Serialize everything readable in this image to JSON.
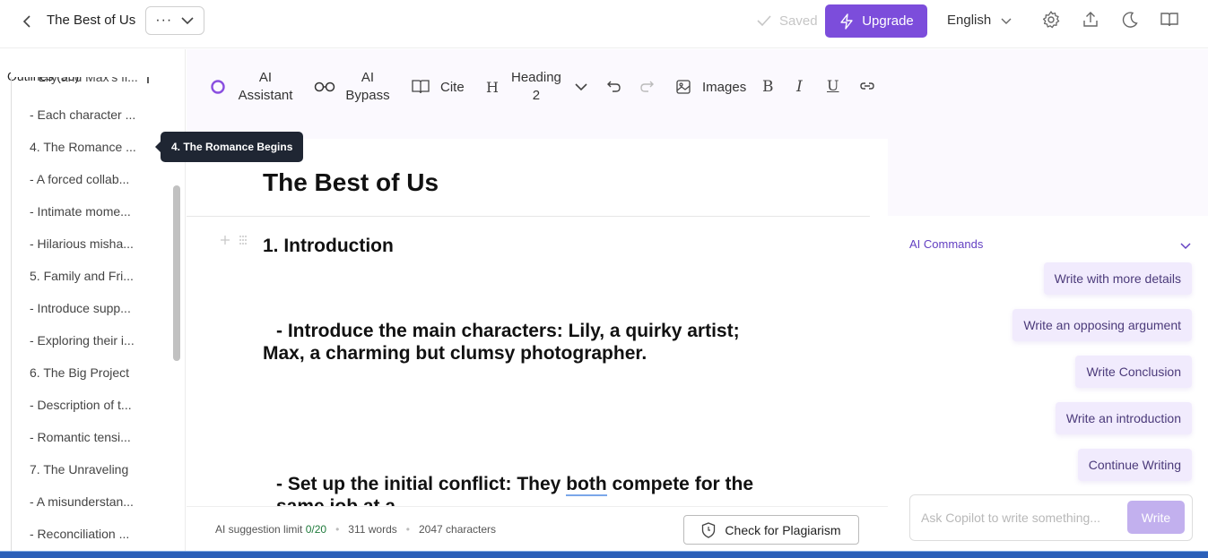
{
  "header": {
    "doc_title": "The Best of Us",
    "more_label": "···",
    "saved_label": "Saved",
    "upgrade_label": "Upgrade",
    "language": "English",
    "colors": {
      "accent": "#7c4ddb"
    }
  },
  "sidebar": {
    "outlines_label": "Outlines (35)",
    "items": [
      "Lily and Max's fi...",
      "- Each character ...",
      "4. The Romance ...",
      "- A forced collab...",
      "- Intimate mome...",
      "- Hilarious misha...",
      "5. Family and Fri...",
      "- Introduce supp...",
      "- Exploring their i...",
      "6. The Big Project",
      "- Description of t...",
      "- Romantic tensi...",
      "7. The Unraveling",
      "- A misunderstan...",
      "- Reconciliation ..."
    ],
    "tooltip": "4. The Romance Begins"
  },
  "toolbar": {
    "ai_assistant": "AI Assistant",
    "ai_bypass": "AI Bypass",
    "cite": "Cite",
    "heading": "Heading 2",
    "images": "Images"
  },
  "editor": {
    "title": "The Best of Us",
    "h1": "1. Introduction",
    "p1": "- Introduce the main characters: Lily, a quirky artist; Max, a charming but clumsy photographer.",
    "p2_a": "- Set up the initial conflict: They ",
    "p2_both": "both",
    "p2_b": " compete for the",
    "p2_cut": "same job at a..."
  },
  "status": {
    "limit_label": "AI suggestion limit",
    "limit_value": "0/20",
    "words": "311 words",
    "chars": "2047 characters",
    "plagiarism": "Check for Plagiarism"
  },
  "ai": {
    "header": "AI Commands",
    "commands": [
      "Write with more details",
      "Write an opposing argument",
      "Write Conclusion",
      "Write an introduction",
      "Continue Writing"
    ],
    "ask_placeholder": "Ask Copilot to write something...",
    "write_label": "Write"
  }
}
